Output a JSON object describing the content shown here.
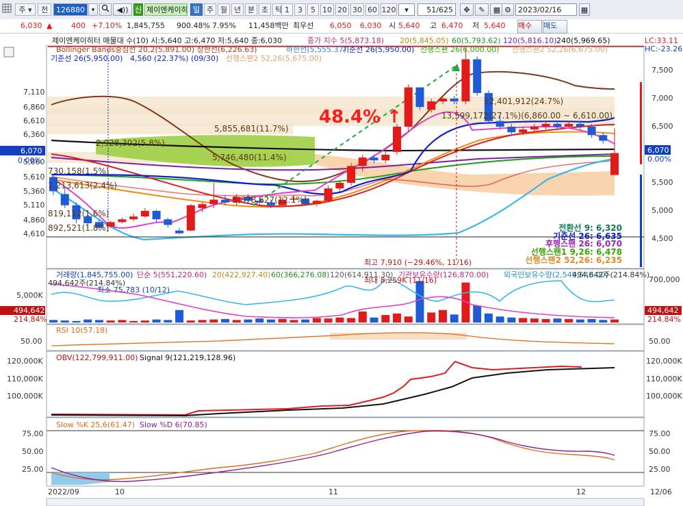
{
  "toolbar": {
    "market": "주",
    "period_prefix": "전",
    "stock_code": "126880",
    "badge": "신",
    "stock_name": "제이엔케이히",
    "periods": [
      "일",
      "주",
      "월",
      "년",
      "분",
      "초",
      "틱"
    ],
    "intervals": [
      "1",
      "3",
      "5",
      "10",
      "20",
      "30",
      "60",
      "120"
    ],
    "page_counter": "51/625",
    "date": "2023/02/16"
  },
  "pricebar": {
    "price": "6,030",
    "change": "400",
    "change_pct": "+7.10%",
    "volume": "1,845,755",
    "volume_ratio": "900.48%",
    "turnover": "7.95%",
    "trade_value": "11,458백만",
    "pref_label": "최우선",
    "ask": "6,050",
    "bid": "6,030",
    "open_label": "시",
    "open": "5,640",
    "high_label": "고",
    "high": "6,470",
    "low_label": "저",
    "low": "5,640",
    "buy_label": "매수",
    "sell_label": "매도"
  },
  "colors": {
    "up": "#e21a1a",
    "down": "#1f5bd6",
    "flat": "#111111",
    "bb_mid": "#7a3b16",
    "cloud": "#f7cfa6",
    "cloud2": "#98cc3a"
  },
  "legend": {
    "line1": "제이엔케이히터 매물대 수(10) 시:5,640 고:6,470 저:5,640 종:6,030",
    "ma5": "종가 지수 5(5,873.18)",
    "ma20": "20(5,845.05)",
    "ma60": "60(5,793.62)",
    "ma120": "120(5,816.10)",
    "ma240": "240(5,969.65)",
    "bb": "Bollinger Bands중심선 20,2(5,891.00) 상한선(6,226.63)",
    "bb_low": "하한선(5,555.37)",
    "kijun": "기준선 26(5,950.00)",
    "senkou": "선행스팬 26(6,000.00)",
    "senkou2_hidden": "선행스팬2 52,26(6,675.00)",
    "line3": "기준선 26(5,950.00)",
    "line3b": "4,560 (22.37%) (09/30)",
    "line3c": "선행스팬2 52,26(5,675.00)"
  },
  "lc_label": "LC:33.11",
  "hc_label": "HC:-23.26",
  "y_right_ticks": [
    "7,500",
    "7,000",
    "6,500",
    "6,000",
    "5,500",
    "5,000",
    "4,500"
  ],
  "y_left_ticks": [
    "7,110",
    "6,860",
    "6,610",
    "6,360",
    "6,110",
    "5,860",
    "5,610",
    "5,360",
    "5,110",
    "4,860",
    "4,610"
  ],
  "cur_price_tag": "6,070",
  "cur_pct_tag": "0.00%",
  "volume_profile_labels": [
    "12,401,912(24.7%)",
    "13,599,172(27.1%)(6,860.00 ~ 6,610.00)",
    "5,855,681(11.7%)",
    "2,928,302(5.8%)",
    "5,746,480(11.4%)",
    "730,158(1.5%)",
    "1,213,613(2.4%)",
    "819,112(1.6%)",
    "892,521(1.8%)",
    "5,878,627(12.1%)"
  ],
  "big_annotation": "48.4% ↑",
  "high_note": "최고 7,910 (−29.46%, 11/16)",
  "ichimoku_legend": [
    {
      "label": "전환선 9: 6,320",
      "color": "#0a7a5a"
    },
    {
      "label": "기준선 26: 6,635",
      "color": "#1020c8"
    },
    {
      "label": "후행스팬 26: 6,070",
      "color": "#9b27b0"
    },
    {
      "label": "선행스팬1 9,26: 6,478",
      "color": "#3aa400"
    },
    {
      "label": "선행스팬2 52,26: 6,235",
      "color": "#e08a2a"
    }
  ],
  "volume_panel": {
    "legend": [
      "거래량(1,845,755.00)",
      "단순 5(551,220.60)",
      "20(422,927.40)",
      "60(366,276.08)",
      "120(614,911.30)",
      "기관보유수량(126,870.00)",
      "외국인보유수량(2,549,548.00)"
    ],
    "note_left": "494,642주(214.84%)",
    "note_min": "최소 75,783 (10/12)",
    "note_max": "최대 8,259K (11/16)",
    "note_right": "494,642주(214.84%)",
    "y_left": "5,000K",
    "y_right": "700,000",
    "tag_left": "494,642",
    "tag_left_pct": "214.84%",
    "tag_right": "494,642",
    "tag_right_pct": "214.84%",
    "bars": [
      0.5,
      0.4,
      0.3,
      0.6,
      0.5,
      0.4,
      0.5,
      0.3,
      0.4,
      0.6,
      0.5,
      2.5,
      0.4,
      0.5,
      0.6,
      0.7,
      0.5,
      0.6,
      0.8,
      0.6,
      0.7,
      0.5,
      0.6,
      0.9,
      0.8,
      1.0,
      0.9,
      2.2,
      1.0,
      1.5,
      1.8,
      1.2,
      8.3,
      2.0,
      2.5,
      1.6,
      8.0,
      3.4,
      1.8,
      1.2,
      1.0,
      0.9,
      0.8,
      0.7,
      0.8,
      0.7,
      0.6,
      0.7,
      0.5,
      0.6
    ]
  },
  "rsi_panel": {
    "label": "RSI 10(57.18)",
    "tick": "50.00"
  },
  "obv_panel": {
    "label": "OBV(122,799,911.00)",
    "signal": "Signal 9(121,219,128.96)",
    "ticks": [
      "120,000K",
      "110,000K",
      "100,000K"
    ]
  },
  "stoch_panel": {
    "label_k": "Slow %K 25,6(61.47)",
    "label_d": "Slow %D 6(70.85)",
    "ticks": [
      "75.00",
      "50.00",
      "25.00"
    ]
  },
  "x_labels": [
    "2022/09",
    "10",
    "11",
    "12",
    "12/06"
  ],
  "candles": [
    [
      5600,
      5650,
      5280,
      5350
    ],
    [
      5300,
      5400,
      5050,
      5100
    ],
    [
      5100,
      5150,
      4780,
      4850
    ],
    [
      4900,
      4950,
      4700,
      4780
    ],
    [
      4800,
      4850,
      4650,
      4700
    ],
    [
      4720,
      4820,
      4700,
      4800
    ],
    [
      4800,
      4880,
      4780,
      4850
    ],
    [
      4850,
      4950,
      4820,
      4900
    ],
    [
      4900,
      5050,
      4880,
      5000
    ],
    [
      5000,
      5020,
      4800,
      4850
    ],
    [
      4850,
      4880,
      4700,
      4750
    ],
    [
      4650,
      4700,
      4590,
      4600
    ],
    [
      4650,
      5120,
      4640,
      5100
    ],
    [
      5050,
      5150,
      4980,
      5120
    ],
    [
      5120,
      5500,
      5050,
      5200
    ],
    [
      5200,
      5280,
      5100,
      5150
    ],
    [
      5150,
      5300,
      5100,
      5250
    ],
    [
      5250,
      5300,
      5150,
      5180
    ],
    [
      5180,
      5260,
      5100,
      5150
    ],
    [
      5150,
      5200,
      5050,
      5100
    ],
    [
      5100,
      5250,
      5080,
      5200
    ],
    [
      5200,
      5280,
      5150,
      5220
    ],
    [
      5220,
      5250,
      5100,
      5120
    ],
    [
      5120,
      5200,
      5080,
      5180
    ],
    [
      5180,
      5450,
      5150,
      5400
    ],
    [
      5400,
      5550,
      5350,
      5500
    ],
    [
      5500,
      5850,
      5450,
      5800
    ],
    [
      5800,
      6000,
      5700,
      5950
    ],
    [
      5950,
      6000,
      5850,
      5900
    ],
    [
      5900,
      6100,
      5850,
      6000
    ],
    [
      6050,
      6550,
      6000,
      6500
    ],
    [
      6500,
      7250,
      6400,
      7200
    ],
    [
      7200,
      7200,
      6800,
      6850
    ],
    [
      6800,
      7000,
      6750,
      6950
    ],
    [
      6950,
      7050,
      6900,
      7000
    ],
    [
      7000,
      7050,
      6900,
      6950
    ],
    [
      6950,
      7910,
      6900,
      7700
    ],
    [
      7700,
      7750,
      7050,
      7100
    ],
    [
      7100,
      7150,
      6550,
      6600
    ],
    [
      6600,
      6700,
      6450,
      6500
    ],
    [
      6500,
      6550,
      6350,
      6400
    ],
    [
      6400,
      6500,
      6350,
      6450
    ],
    [
      6450,
      6550,
      6400,
      6500
    ],
    [
      6500,
      6600,
      6450,
      6550
    ],
    [
      6550,
      6600,
      6450,
      6500
    ],
    [
      6500,
      6600,
      6480,
      6550
    ],
    [
      6550,
      6600,
      6450,
      6500
    ],
    [
      6500,
      6550,
      6300,
      6350
    ],
    [
      6350,
      6400,
      6200,
      6250
    ],
    [
      5640,
      6470,
      5640,
      6030
    ]
  ]
}
